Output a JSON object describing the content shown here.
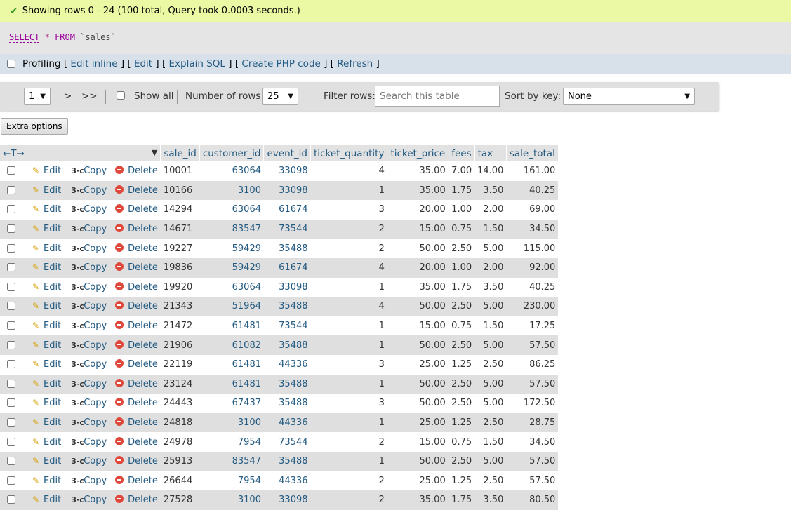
{
  "status": {
    "message": "Showing rows 0 - 24 (100 total, Query took 0.0003 seconds.)",
    "check_icon": "check-icon"
  },
  "sql": {
    "select": "SELECT",
    "star": "*",
    "from": "FROM",
    "table": "`sales`"
  },
  "profiling": {
    "label": "Profiling",
    "links": [
      "Edit inline",
      "Edit",
      "Explain SQL",
      "Create PHP code",
      "Refresh"
    ]
  },
  "nav": {
    "page": "1",
    "next": ">",
    "last": ">>",
    "show_all": "Show all",
    "rows_label": "Number of rows:",
    "rows_value": "25",
    "filter_label": "Filter rows:",
    "filter_placeholder": "Search this table",
    "sort_label": "Sort by key:",
    "sort_value": "None"
  },
  "extra_options": "Extra options",
  "table": {
    "arrows": "←T→",
    "columns": [
      "sale_id",
      "customer_id",
      "event_id",
      "ticket_quantity",
      "ticket_price",
      "fees",
      "tax",
      "sale_total"
    ],
    "actions": {
      "edit": "Edit",
      "copy": "Copy",
      "delete": "Delete"
    },
    "rows": [
      [
        "10001",
        "63064",
        "33098",
        "4",
        "35.00",
        "7.00",
        "14.00",
        "161.00"
      ],
      [
        "10166",
        "3100",
        "33098",
        "1",
        "35.00",
        "1.75",
        "3.50",
        "40.25"
      ],
      [
        "14294",
        "63064",
        "61674",
        "3",
        "20.00",
        "1.00",
        "2.00",
        "69.00"
      ],
      [
        "14671",
        "83547",
        "73544",
        "2",
        "15.00",
        "0.75",
        "1.50",
        "34.50"
      ],
      [
        "19227",
        "59429",
        "35488",
        "2",
        "50.00",
        "2.50",
        "5.00",
        "115.00"
      ],
      [
        "19836",
        "59429",
        "61674",
        "4",
        "20.00",
        "1.00",
        "2.00",
        "92.00"
      ],
      [
        "19920",
        "63064",
        "33098",
        "1",
        "35.00",
        "1.75",
        "3.50",
        "40.25"
      ],
      [
        "21343",
        "51964",
        "35488",
        "4",
        "50.00",
        "2.50",
        "5.00",
        "230.00"
      ],
      [
        "21472",
        "61481",
        "73544",
        "1",
        "15.00",
        "0.75",
        "1.50",
        "17.25"
      ],
      [
        "21906",
        "61082",
        "35488",
        "1",
        "50.00",
        "2.50",
        "5.00",
        "57.50"
      ],
      [
        "22119",
        "61481",
        "44336",
        "3",
        "25.00",
        "1.25",
        "2.50",
        "86.25"
      ],
      [
        "23124",
        "61481",
        "35488",
        "1",
        "50.00",
        "2.50",
        "5.00",
        "57.50"
      ],
      [
        "24443",
        "67437",
        "35488",
        "3",
        "50.00",
        "2.50",
        "5.00",
        "172.50"
      ],
      [
        "24818",
        "3100",
        "44336",
        "1",
        "25.00",
        "1.25",
        "2.50",
        "28.75"
      ],
      [
        "24978",
        "7954",
        "73544",
        "2",
        "15.00",
        "0.75",
        "1.50",
        "34.50"
      ],
      [
        "25913",
        "83547",
        "35488",
        "1",
        "50.00",
        "2.50",
        "5.00",
        "57.50"
      ],
      [
        "26644",
        "7954",
        "44336",
        "2",
        "25.00",
        "1.25",
        "2.50",
        "57.50"
      ],
      [
        "27528",
        "3100",
        "33098",
        "2",
        "35.00",
        "1.75",
        "3.50",
        "80.50"
      ]
    ]
  }
}
